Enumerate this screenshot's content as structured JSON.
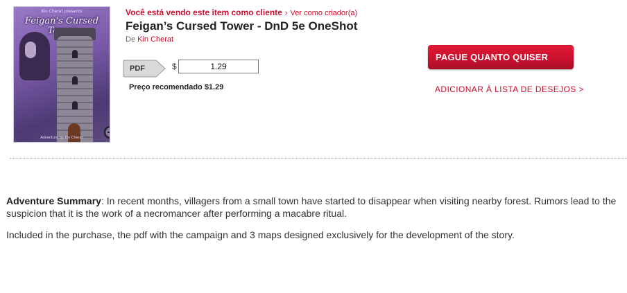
{
  "cover": {
    "title": "Feigan's Cursed Tower",
    "author_line": "Kin Cherat presents",
    "footer_line": "Adventure by Kin Cherat"
  },
  "notice": {
    "viewing_as_client": "Você está vendo este item como cliente",
    "separator": "›",
    "view_as_creator": "Ver como criador(a)"
  },
  "product": {
    "title": "Feigan’s Cursed Tower - DnD 5e OneShot",
    "by_label": "De",
    "author": "Kin Cherat"
  },
  "purchase": {
    "format": "PDF",
    "currency": "$",
    "price_value": "1.29",
    "recommended": "Preço recomendado $1.29",
    "pay_button": "PAGUE QUANTO QUISER",
    "wishlist": "ADICIONAR À LISTA DE DESEJOS >"
  },
  "description": {
    "summary_label": "Adventure Summary",
    "summary_text": ": In recent months, villagers from a small town have started to disappear when visiting nearby forest. Rumors lead to the suspicion that it is the work of a necromancer after performing a macabre ritual.",
    "included_text": "Included in the purchase, the pdf with the campaign and 3 maps designed exclusively for the development of the story."
  },
  "colors": {
    "accent": "#c8102e",
    "cover_purple": "#7a5aa8"
  },
  "icons": {
    "zoom": "zoom-plus-icon",
    "format_tag": "tag-arrow-icon"
  }
}
